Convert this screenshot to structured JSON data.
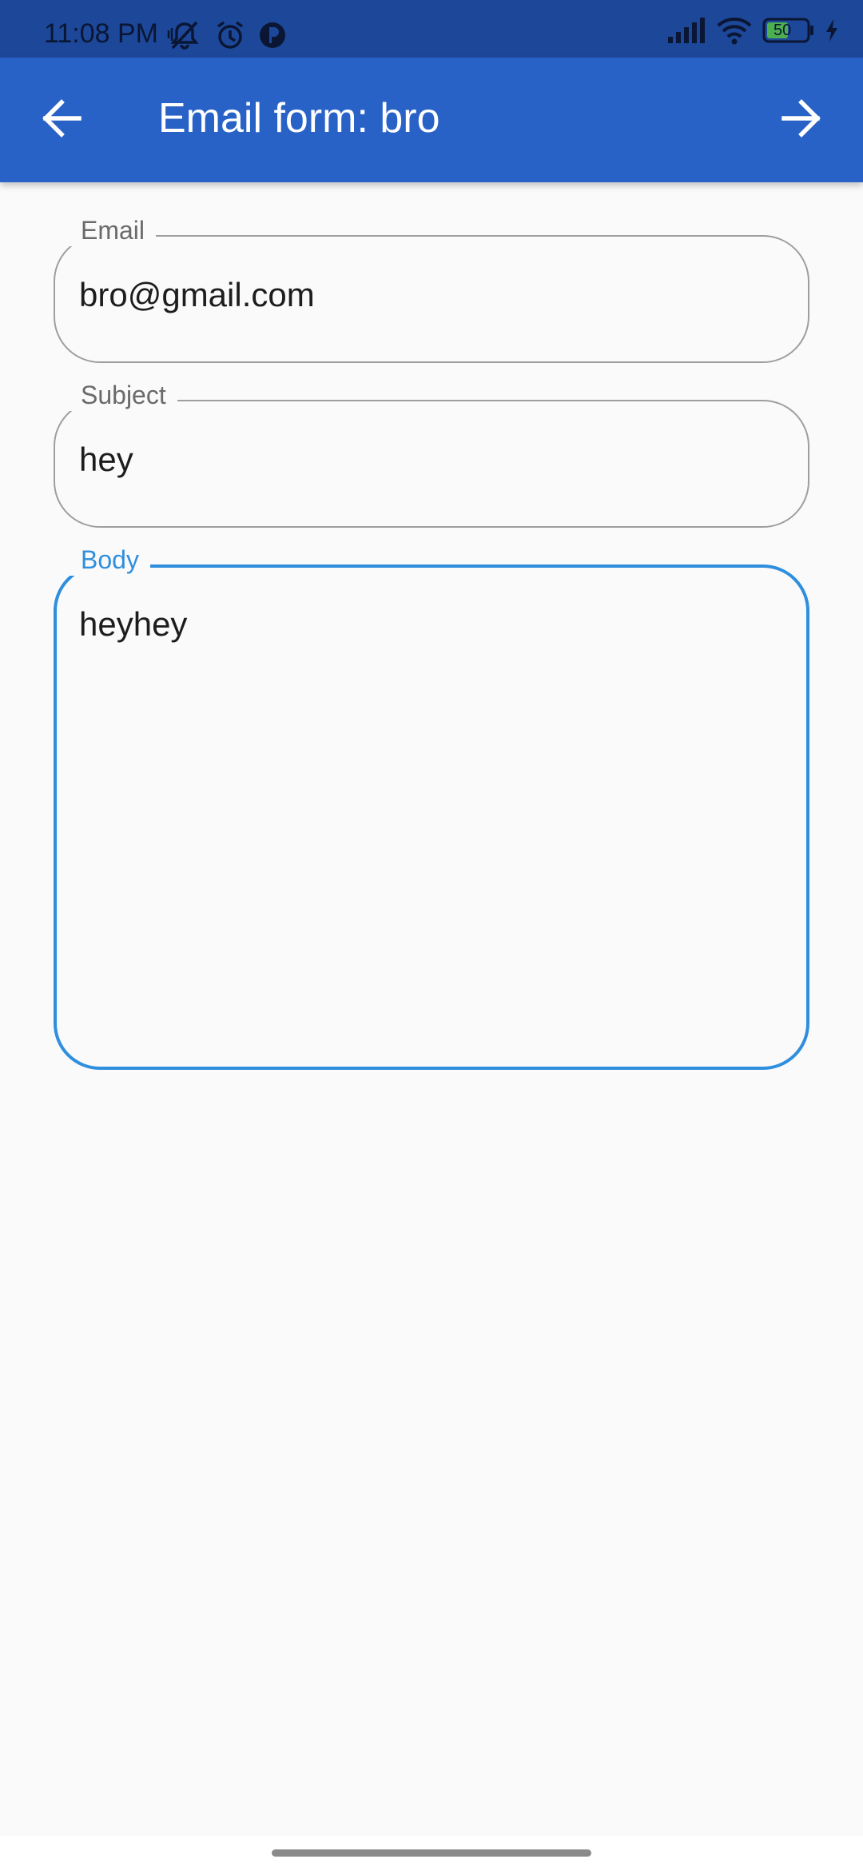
{
  "status_bar": {
    "time": "11:08 PM",
    "left_icons": [
      "muted-notification-icon",
      "alarm-icon",
      "app-indicator-icon"
    ],
    "right_icons": [
      "signal-icon",
      "wifi-icon",
      "battery-icon",
      "charging-icon"
    ],
    "battery_level": "50"
  },
  "app_bar": {
    "title": "Email form: bro",
    "back_icon": "arrow-back-icon",
    "forward_icon": "arrow-forward-icon",
    "background_color": "#2962c7"
  },
  "form": {
    "email": {
      "label": "Email",
      "value": "bro@gmail.com"
    },
    "subject": {
      "label": "Subject",
      "value": "hey"
    },
    "body": {
      "label": "Body",
      "value": "heyhey"
    },
    "focus_color": "#2f8fde"
  }
}
